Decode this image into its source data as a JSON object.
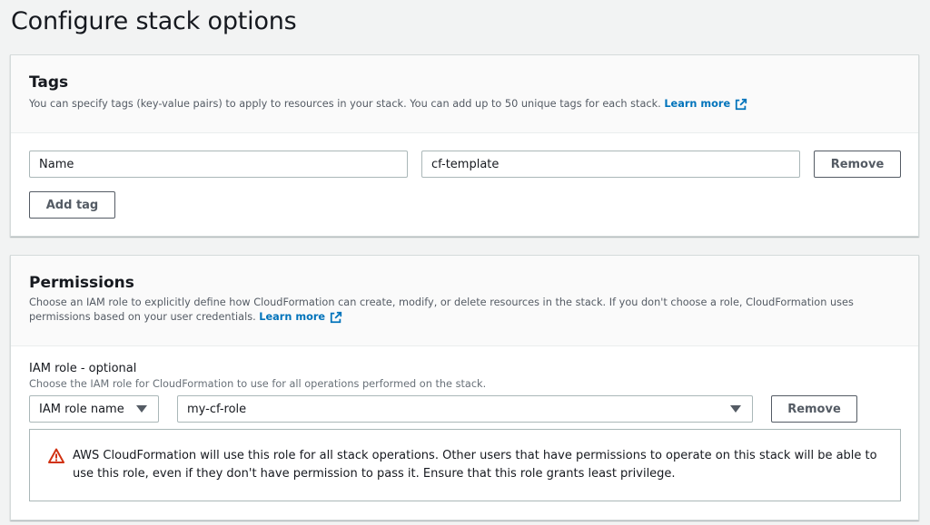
{
  "page": {
    "title": "Configure stack options"
  },
  "tags": {
    "title": "Tags",
    "description": "You can specify tags (key-value pairs) to apply to resources in your stack. You can add up to 50 unique tags for each stack.",
    "learn_more": "Learn more",
    "rows": [
      {
        "key": "Name",
        "value": "cf-template",
        "remove_label": "Remove"
      }
    ],
    "add_tag_label": "Add tag"
  },
  "permissions": {
    "title": "Permissions",
    "description": "Choose an IAM role to explicitly define how CloudFormation can create, modify, or delete resources in the stack. If you don't choose a role, CloudFormation uses permissions based on your user credentials.",
    "learn_more": "Learn more",
    "iam_role": {
      "label": "IAM role - optional",
      "description": "Choose the IAM role for CloudFormation to use for all operations performed on the stack.",
      "type_selected": "IAM role name",
      "role_selected": "my-cf-role",
      "remove_label": "Remove"
    },
    "warning": "AWS CloudFormation will use this role for all stack operations. Other users that have permissions to operate on this stack will be able to use this role, even if they don't have permission to pass it. Ensure that this role grants least privilege."
  },
  "colors": {
    "link": "#0073bb",
    "warning_icon": "#d13212",
    "background": "#f2f3f3"
  },
  "icons": [
    "external-link-icon",
    "warning-icon",
    "caret-down-icon"
  ]
}
